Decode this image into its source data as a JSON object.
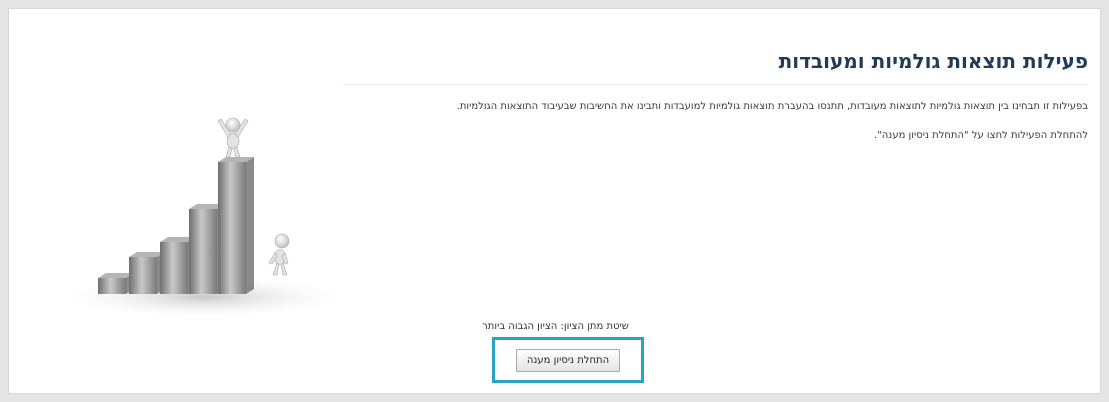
{
  "activity": {
    "title": "פעילות תוצאות גולמיות ומעובדות",
    "description": "בפעילות זו תבחינו בין תוצאות גולמיות לתוצאות מעובדות, תתנסו בהעברת תוצאות גולמיות למועבדות ותבינו את החשיבות שבעיבוד התוצאות הגולמיות.",
    "instruction": "להתחלת הפעילות לחצו על \"התחלת ניסיון מענה\"."
  },
  "grading": {
    "text": "שיטת מתן הציון: הציון הגבוה ביותר"
  },
  "actions": {
    "start_attempt_label": "התחלת ניסיון מענה"
  },
  "colors": {
    "title": "#1f3b57",
    "button_highlight": "#2aa3c2"
  },
  "illustration": {
    "icon": "bar-chart-figures-illustration",
    "bar_count": 5
  }
}
